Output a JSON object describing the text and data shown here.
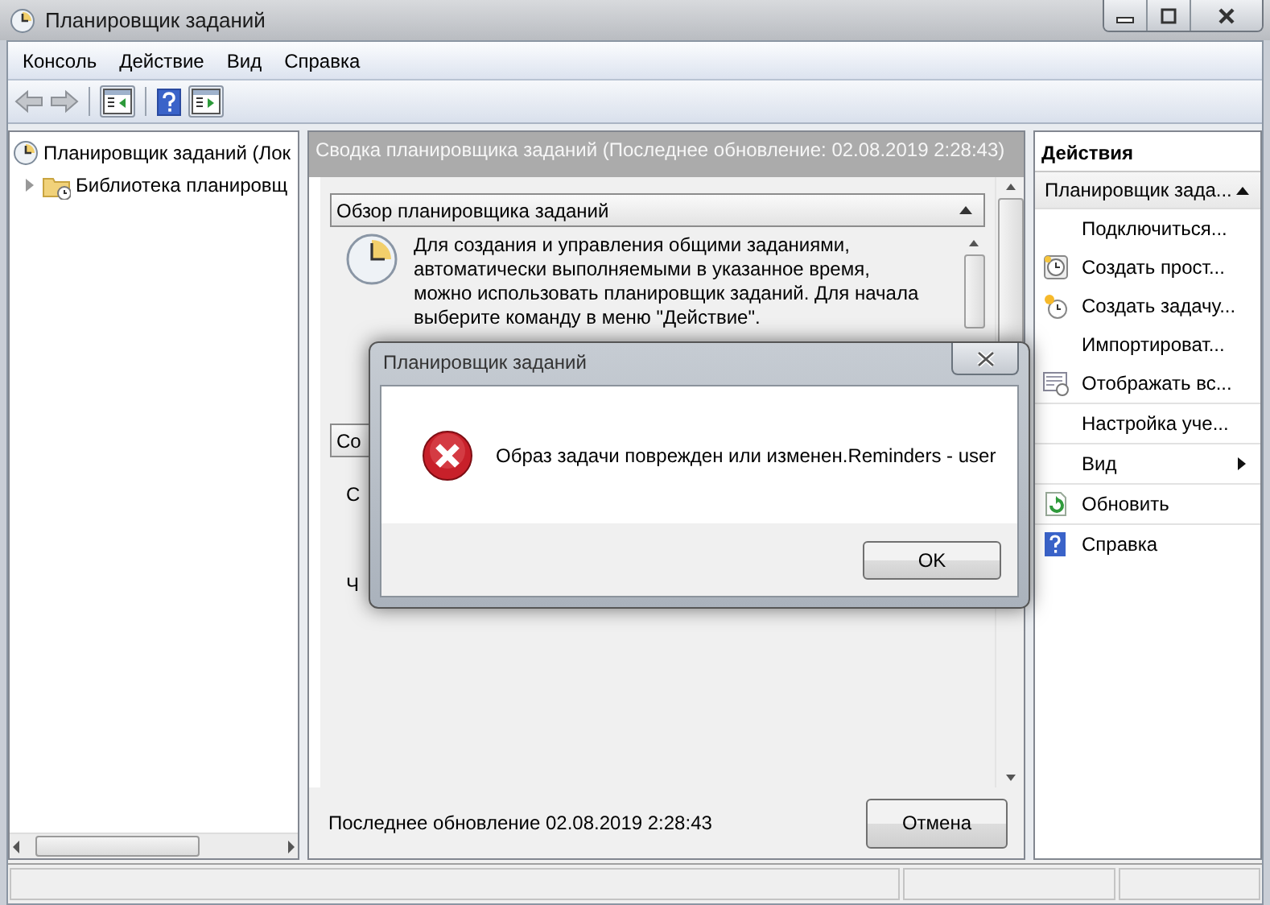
{
  "window": {
    "title": "Планировщик заданий"
  },
  "menu": [
    "Консоль",
    "Действие",
    "Вид",
    "Справка"
  ],
  "tree": [
    {
      "label": "Планировщик заданий (Лок",
      "children": [
        {
          "label": "Библиотека планировщ",
          "expanded": false
        }
      ]
    }
  ],
  "summary": {
    "header": "Сводка планировщика заданий (Последнее обновление: 02.08.2019 2:28:43)",
    "sections": [
      {
        "title": "Обзор планировщика заданий",
        "expanded": true,
        "lines": [
          "Для создания и управления общими заданиями,",
          "автоматически выполняемыми в указанное время,",
          "можно использовать планировщик заданий. Для начала",
          "выберите команду в меню \"Действие\"."
        ]
      },
      {
        "title": "Со",
        "lines": [
          "С",
          "Ч"
        ]
      }
    ],
    "footer": "Последнее обновление 02.08.2019 2:28:43",
    "cancel_button": "Отмена"
  },
  "actions": {
    "title": "Действия",
    "section": {
      "title": "Планировщик зада...",
      "expanded": true
    },
    "groups": [
      {
        "items": [
          {
            "label": "Подключиться...",
            "kind": "plain"
          },
          {
            "label": "Создать прост...",
            "kind": "clock"
          },
          {
            "label": "Создать задачу...",
            "kind": "new-task"
          },
          {
            "label": "Импортироват...",
            "kind": "plain"
          },
          {
            "label": "Отображать вс...",
            "kind": "list"
          }
        ]
      },
      {
        "items": [
          {
            "label": "Настройка уче...",
            "kind": "plain"
          }
        ]
      },
      {
        "items": [
          {
            "label": "Вид",
            "kind": "submenu"
          }
        ]
      },
      {
        "items": [
          {
            "label": "Обновить",
            "kind": "refresh"
          }
        ]
      },
      {
        "items": [
          {
            "label": "Справка",
            "kind": "help"
          }
        ]
      }
    ]
  },
  "dialog": {
    "title": "Планировщик заданий",
    "message": "Образ задачи поврежден или изменен.Reminders - user",
    "button": "OK"
  }
}
